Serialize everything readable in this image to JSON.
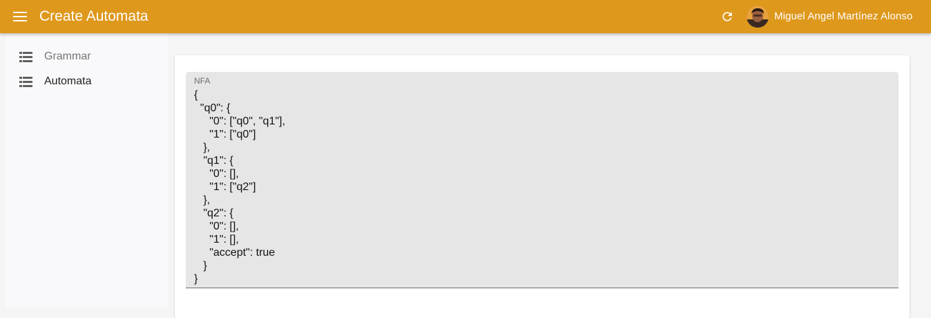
{
  "appbar": {
    "title": "Create Automata",
    "user_name": "Miguel Angel Martínez Alonso",
    "color": "#de981c",
    "menu_icon": "menu-icon",
    "refresh_icon": "refresh-icon"
  },
  "sidebar": {
    "items": [
      {
        "label": "Grammar",
        "icon": "list-icon",
        "active": false
      },
      {
        "label": "Automata",
        "icon": "list-icon",
        "active": true
      }
    ]
  },
  "main": {
    "field_label": "NFA",
    "field_value": "{\n  \"q0\": {\n     \"0\": [\"q0\", \"q1\"],\n     \"1\": [\"q0\"]\n   },\n   \"q1\": {\n     \"0\": [],\n     \"1\": [\"q2\"]\n   },\n   \"q2\": {\n     \"0\": [],\n     \"1\": [],\n     \"accept\": true\n   }\n}"
  }
}
